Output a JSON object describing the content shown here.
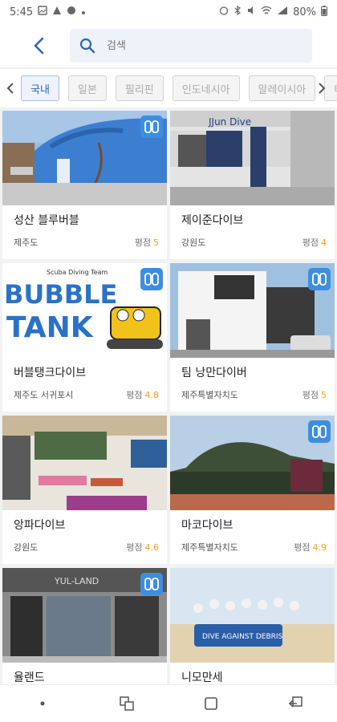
{
  "status": {
    "time": "5:45",
    "battery": "80%"
  },
  "search": {
    "placeholder": "검색"
  },
  "chips": [
    {
      "label": "국내",
      "active": true
    },
    {
      "label": "일본",
      "active": false
    },
    {
      "label": "필리핀",
      "active": false
    },
    {
      "label": "인도네시아",
      "active": false
    },
    {
      "label": "말레이시아",
      "active": false
    },
    {
      "label": "태",
      "active": false
    }
  ],
  "rating_label": "평점",
  "shops": [
    {
      "name": "성산 블루버블",
      "region": "제주도",
      "rating": "5",
      "has_badge": true
    },
    {
      "name": "제이준다이브",
      "region": "강원도",
      "rating": "4",
      "has_badge": false
    },
    {
      "name": "버블탱크다이브",
      "region": "제주도 서귀포시",
      "rating": "4.8",
      "has_badge": true
    },
    {
      "name": "팀 낭만다이버",
      "region": "제주특별자치도",
      "rating": "5",
      "has_badge": true
    },
    {
      "name": "앙파다이브",
      "region": "강원도",
      "rating": "4.6",
      "has_badge": false
    },
    {
      "name": "마코다이브",
      "region": "제주특별자치도",
      "rating": "4.9",
      "has_badge": true
    },
    {
      "name": "율랜드",
      "region": "",
      "rating": "",
      "has_badge": true
    },
    {
      "name": "니모만세",
      "region": "",
      "rating": "",
      "has_badge": false
    }
  ],
  "photo_signs": {
    "jjun_sign": "JJun Dive",
    "bubble_line1": "Scuba Diving Team",
    "bubble_line2": "BUBBLE",
    "bubble_line3": "TANK",
    "yul_sign": "YUL-LAND",
    "dive_banner": "DIVE AGAINST DEBRIS"
  },
  "colors": {
    "accent": "#2f65b3",
    "badge": "#3e8ee0",
    "rating_value": "#f0a020"
  },
  "icons": {
    "back": "back-arrow-icon",
    "search": "search-icon",
    "badge": "dive-logo-icon"
  }
}
